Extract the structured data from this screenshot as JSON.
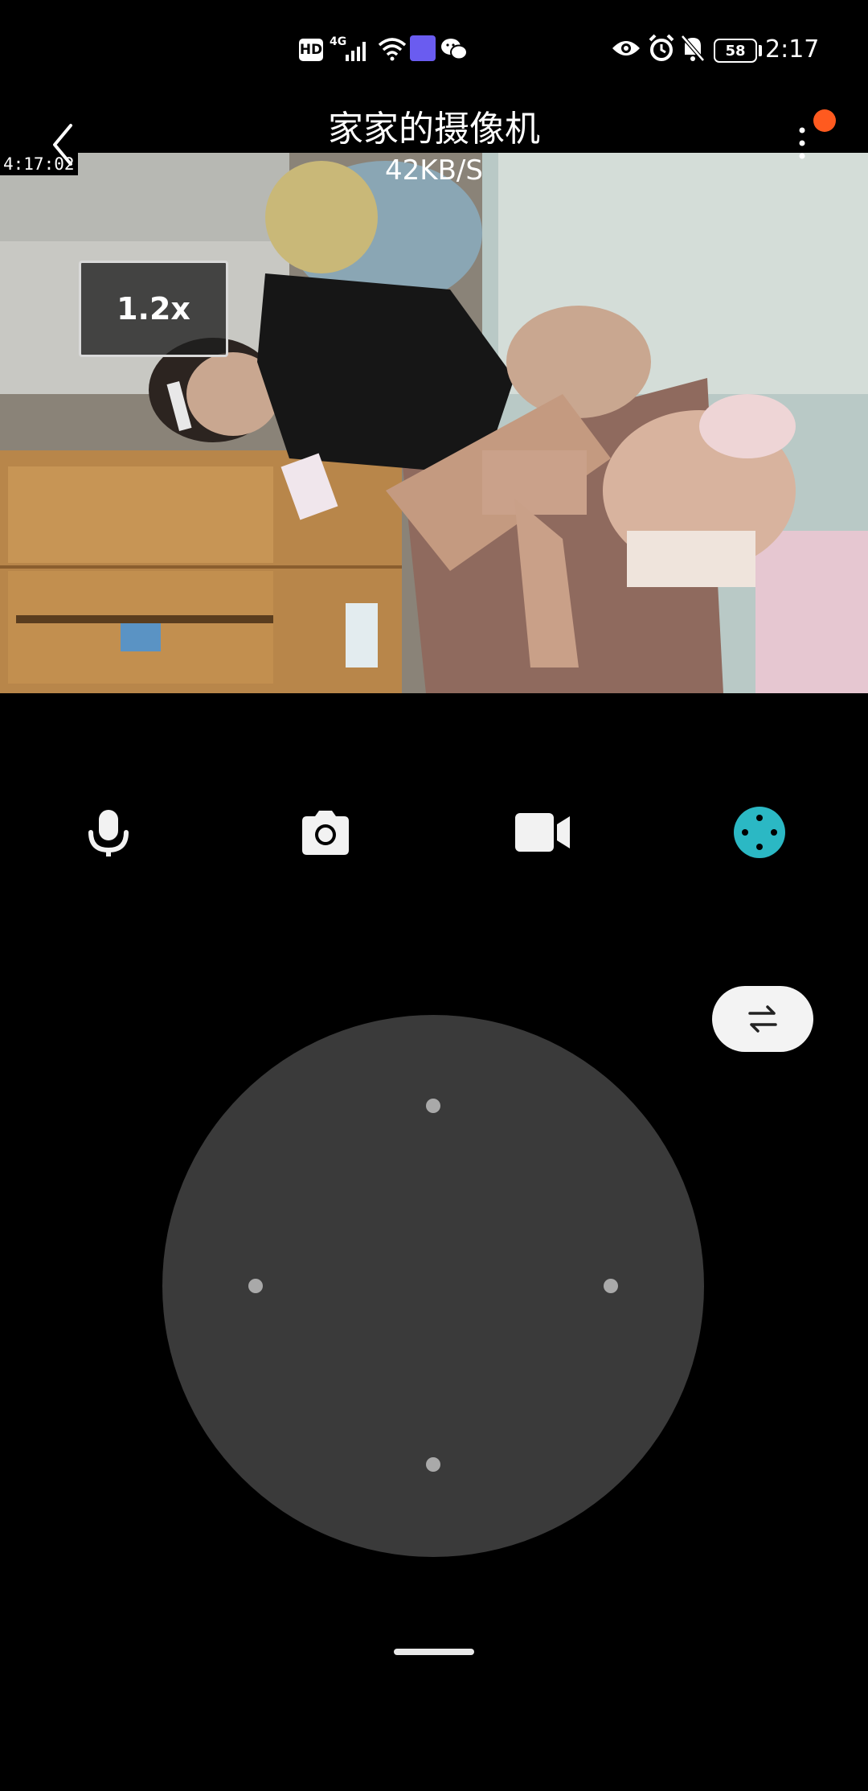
{
  "status_bar": {
    "hd": "HD",
    "network": "4G",
    "battery": "58",
    "time": "2:17"
  },
  "header": {
    "title": "家家的摄像机",
    "bitrate": "42KB/S",
    "notification_dot_color": "#ff5a1f"
  },
  "video": {
    "timestamp": "4:17:02",
    "zoom": "1.2x"
  },
  "controls": [
    {
      "name": "microphone-icon"
    },
    {
      "name": "camera-icon"
    },
    {
      "name": "video-record-icon"
    },
    {
      "name": "ptz-direction-icon",
      "active": true,
      "color": "#2bb8c4"
    }
  ],
  "switch_button": {
    "icon": "swap-arrows-icon"
  },
  "joystick": {
    "directions": [
      "up",
      "down",
      "left",
      "right"
    ]
  }
}
